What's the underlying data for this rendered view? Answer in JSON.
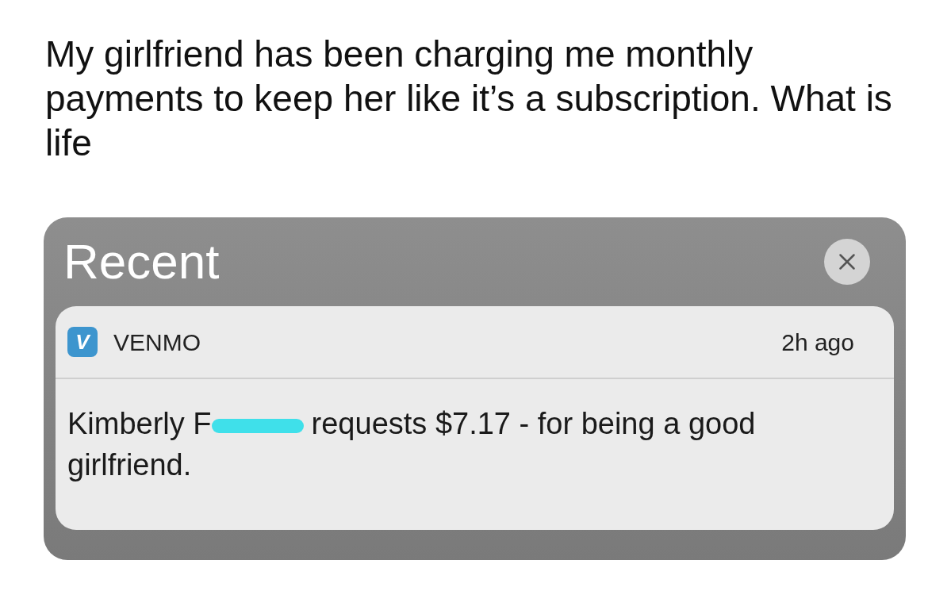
{
  "post": {
    "text": "My girlfriend has been charging me monthly payments to keep her like it’s a subscription. What is life"
  },
  "notifications": {
    "title": "Recent",
    "items": [
      {
        "app_letter": "V",
        "app": "VENMO",
        "time": "2h ago",
        "message_before": "Kimberly F",
        "redacted": true,
        "message_after": "requests $7.17 - for being a good girlfriend."
      }
    ]
  }
}
